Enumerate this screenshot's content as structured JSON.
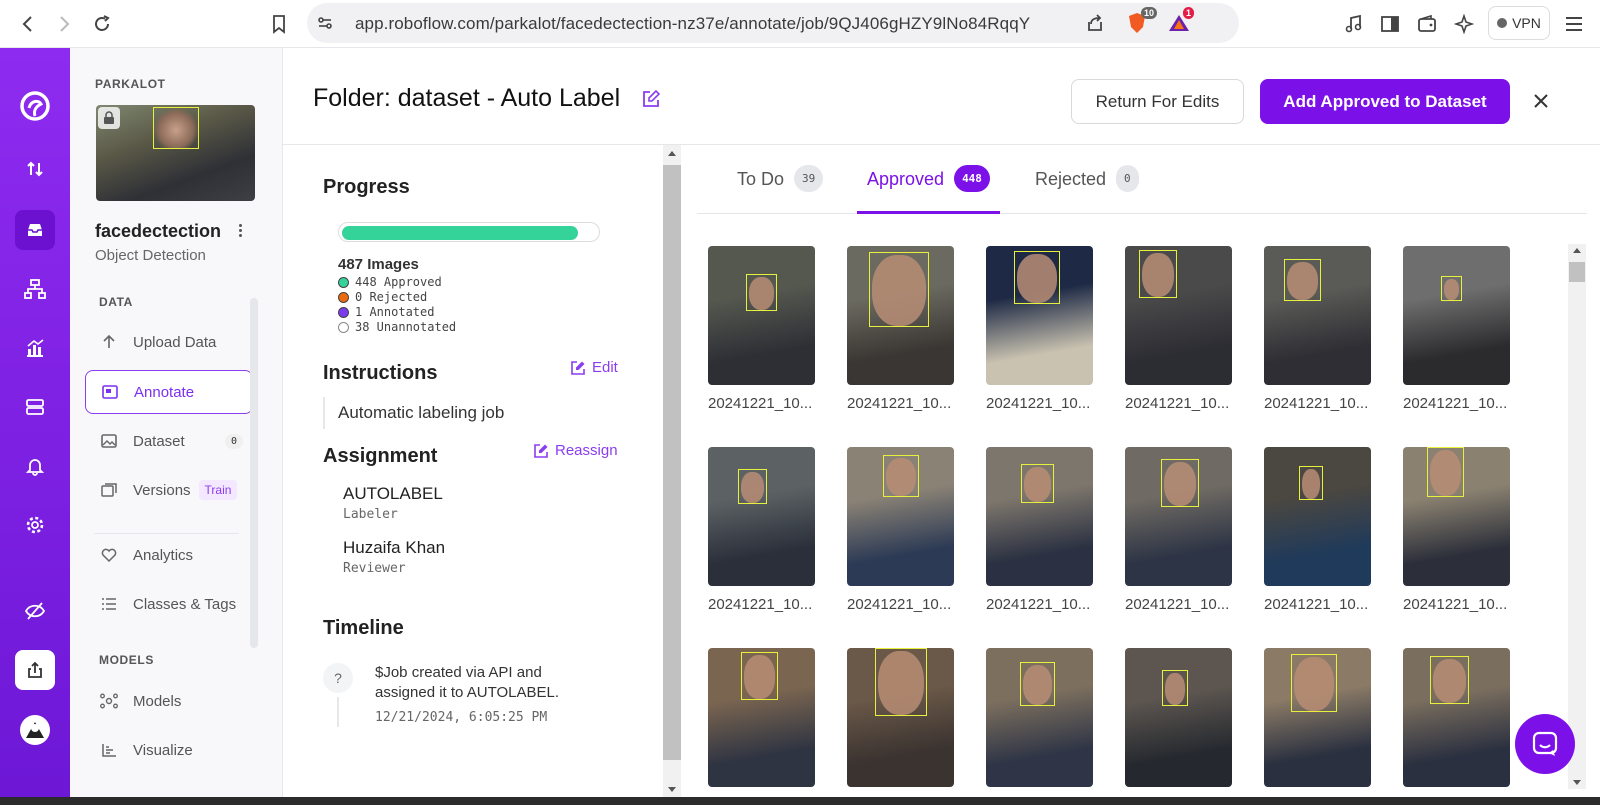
{
  "browser": {
    "url": "app.roboflow.com/parkalot/facedectection-nz37e/annotate/job/9QJ406gHZY9lNo84RqqY",
    "brave_badge": "10",
    "alert_badge": "1",
    "vpn_label": "VPN"
  },
  "sidebar": {
    "workspace": "PARKALOT",
    "project_name": "facedectection",
    "project_type": "Object Detection",
    "section_data": "DATA",
    "section_models": "MODELS",
    "items": [
      {
        "label": "Upload Data"
      },
      {
        "label": "Annotate"
      },
      {
        "label": "Dataset",
        "badge": "0"
      },
      {
        "label": "Versions",
        "tag": "Train"
      },
      {
        "label": "Analytics"
      },
      {
        "label": "Classes & Tags"
      },
      {
        "label": "Models"
      },
      {
        "label": "Visualize"
      }
    ]
  },
  "header": {
    "title": "Folder: dataset - Auto Label",
    "return_label": "Return For Edits",
    "add_label": "Add Approved to Dataset"
  },
  "details": {
    "progress_title": "Progress",
    "progress_fraction": 0.92,
    "images_label": "487 Images",
    "legend": [
      {
        "label": "448 Approved",
        "color": "#34d399"
      },
      {
        "label": "0 Rejected",
        "color": "#ea6a0c"
      },
      {
        "label": "1 Annotated",
        "color": "#7c3aed"
      },
      {
        "label": "38 Unannotated",
        "color": "#ffffff"
      }
    ],
    "instructions_title": "Instructions",
    "edit_label": "Edit",
    "instructions_text": "Automatic labeling job",
    "assignment_title": "Assignment",
    "reassign_label": "Reassign",
    "labeler_name": "AUTOLABEL",
    "labeler_role": "Labeler",
    "reviewer_name": "Huzaifa Khan",
    "reviewer_role": "Reviewer",
    "timeline_title": "Timeline",
    "timeline_icon": "?",
    "timeline_text": "$Job created via API and assigned it to AUTOLABEL.",
    "timeline_date": "12/21/2024, 6:05:25 PM"
  },
  "tabs": [
    {
      "label": "To Do",
      "count": "39"
    },
    {
      "label": "Approved",
      "count": "448"
    },
    {
      "label": "Rejected",
      "count": "0"
    }
  ],
  "images": [
    {
      "filename": "20241221_10..."
    },
    {
      "filename": "20241221_10..."
    },
    {
      "filename": "20241221_10..."
    },
    {
      "filename": "20241221_10..."
    },
    {
      "filename": "20241221_10..."
    },
    {
      "filename": "20241221_10..."
    },
    {
      "filename": "20241221_10..."
    },
    {
      "filename": "20241221_10..."
    },
    {
      "filename": "20241221_10..."
    },
    {
      "filename": "20241221_10..."
    },
    {
      "filename": "20241221_10..."
    },
    {
      "filename": "20241221_10..."
    },
    {
      "filename": ""
    },
    {
      "filename": ""
    },
    {
      "filename": ""
    },
    {
      "filename": ""
    },
    {
      "filename": ""
    },
    {
      "filename": ""
    }
  ],
  "colors": {
    "accent": "#7c10e8",
    "approved": "#34d399",
    "bbox": "#e7f03a"
  }
}
